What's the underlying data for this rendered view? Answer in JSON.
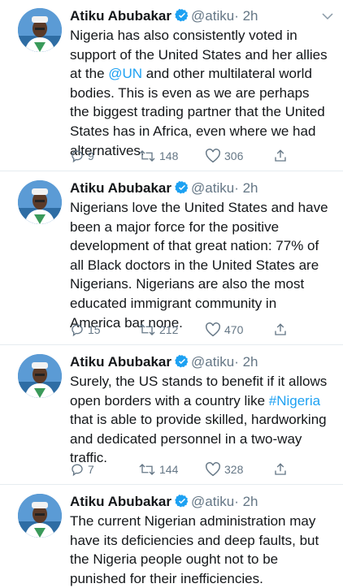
{
  "tweets": [
    {
      "author": "Atiku Abubakar",
      "handle": "@atiku",
      "time": "· 2h",
      "text_segments": [
        {
          "text": "Nigeria has also consistently voted in support of the United States and her allies at the ",
          "link": false
        },
        {
          "text": "@UN",
          "link": true
        },
        {
          "text": " and other multilateral world bodies. This is even as we are perhaps the biggest trading partner that the United States has in Africa, even where we had alternatives.",
          "link": false
        }
      ],
      "replies": "9",
      "retweets": "148",
      "likes": "306"
    },
    {
      "author": "Atiku Abubakar",
      "handle": "@atiku",
      "time": "· 2h",
      "text_segments": [
        {
          "text": "Nigerians love the United States and have been a major force for the positive development of that great nation: 77% of all Black doctors in the United States are Nigerians. Nigerians are also the most educated immigrant community in America bar none.",
          "link": false
        }
      ],
      "replies": "15",
      "retweets": "212",
      "likes": "470"
    },
    {
      "author": "Atiku Abubakar",
      "handle": "@atiku",
      "time": "· 2h",
      "text_segments": [
        {
          "text": "Surely, the US stands to benefit if it allows open borders with a country like ",
          "link": false
        },
        {
          "text": "#Nigeria",
          "link": true
        },
        {
          "text": " that is able to provide skilled, hardworking and dedicated personnel in a two-way traffic.",
          "link": false
        }
      ],
      "replies": "7",
      "retweets": "144",
      "likes": "328"
    },
    {
      "author": "Atiku Abubakar",
      "handle": "@atiku",
      "time": "· 2h",
      "text_segments": [
        {
          "text": "The current Nigerian administration may have its deficiencies and deep faults, but the Nigeria people ought not to be punished for their inefficiencies.",
          "link": false
        }
      ],
      "replies": "",
      "retweets": "",
      "likes": ""
    }
  ],
  "colors": {
    "text": "#14171a",
    "secondary": "#657786",
    "link": "#1da1f2",
    "verified": "#1da1f2",
    "divider": "#e6ecf0"
  },
  "icons": [
    "verified-badge-icon",
    "chevron-down-icon",
    "reply-icon",
    "retweet-icon",
    "like-icon",
    "share-icon"
  ]
}
